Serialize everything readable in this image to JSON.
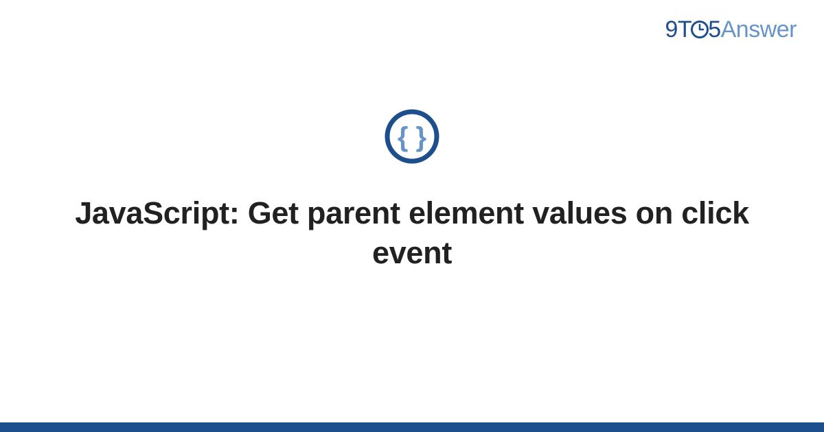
{
  "brand": {
    "part_9": "9",
    "part_t": "T",
    "part_5": "5",
    "part_answer": "Answer"
  },
  "title": "JavaScript: Get parent element values on click event",
  "colors": {
    "brand_dark": "#1c4f8c",
    "brand_light": "#6794c8",
    "text": "#212121"
  }
}
